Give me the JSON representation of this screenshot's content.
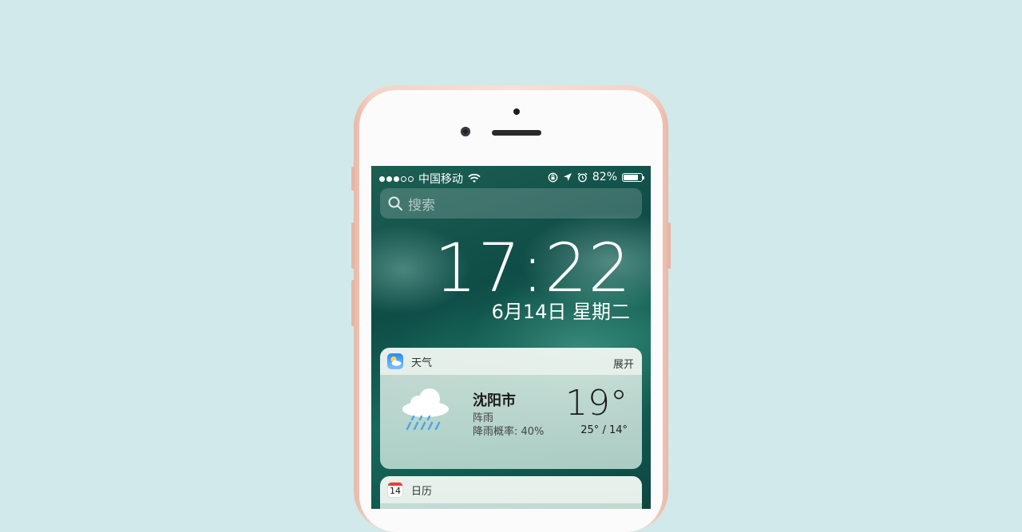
{
  "status_bar": {
    "carrier": "中国移动",
    "battery_percent": "82%",
    "battery_level": 0.82,
    "signal_bars_filled": 3,
    "signal_bars_total": 5
  },
  "search": {
    "placeholder": "搜索"
  },
  "lock": {
    "time": "17:22",
    "date": "6月14日 星期二"
  },
  "weather_widget": {
    "title": "天气",
    "action": "展开",
    "city": "沈阳市",
    "condition": "阵雨",
    "rain_chance": "降雨概率: 40%",
    "temperature": "19°",
    "range": "25° / 14°"
  },
  "calendar_widget": {
    "title": "日历",
    "icon_day": "14"
  }
}
